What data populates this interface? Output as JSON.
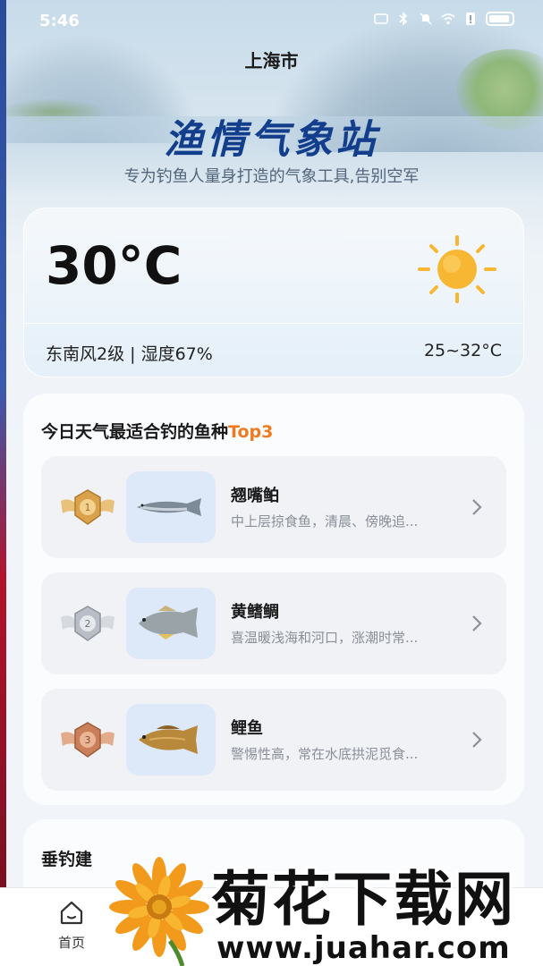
{
  "status_bar": {
    "time": "5:46"
  },
  "header": {
    "city": "上海市",
    "app_title": "渔情气象站",
    "subtitle": "专为钓鱼人量身打造的气象工具,告别空军"
  },
  "weather": {
    "temperature": "30°C",
    "wind_humidity": "东南风2级 | 湿度67%",
    "temp_range": "25~32°C",
    "condition_icon": "sun-icon",
    "colors": {
      "sun": "#f7b733"
    }
  },
  "fish_panel": {
    "title_prefix": "今日天气最适合钓的鱼种",
    "title_accent": "Top3",
    "accent_color": "#f07a20",
    "items": [
      {
        "rank": "1",
        "name": "翘嘴鲌",
        "desc": "中上层掠食鱼，清晨、傍晚追...",
        "medal": "gold-medal-icon",
        "fish": "topmouth-culter-image"
      },
      {
        "rank": "2",
        "name": "黄鳍鲷",
        "desc": "喜温暖浅海和河口，涨潮时常...",
        "medal": "silver-medal-icon",
        "fish": "yellowfin-seabream-image"
      },
      {
        "rank": "3",
        "name": "鲤鱼",
        "desc": "警惕性高，常在水底拱泥觅食...",
        "medal": "bronze-medal-icon",
        "fish": "carp-image"
      }
    ]
  },
  "advice_panel": {
    "title": "垂钓建"
  },
  "bottom_nav": {
    "home_label": "首页"
  },
  "watermark": {
    "cn": "菊花下载网",
    "url": "www.juahar.com"
  }
}
